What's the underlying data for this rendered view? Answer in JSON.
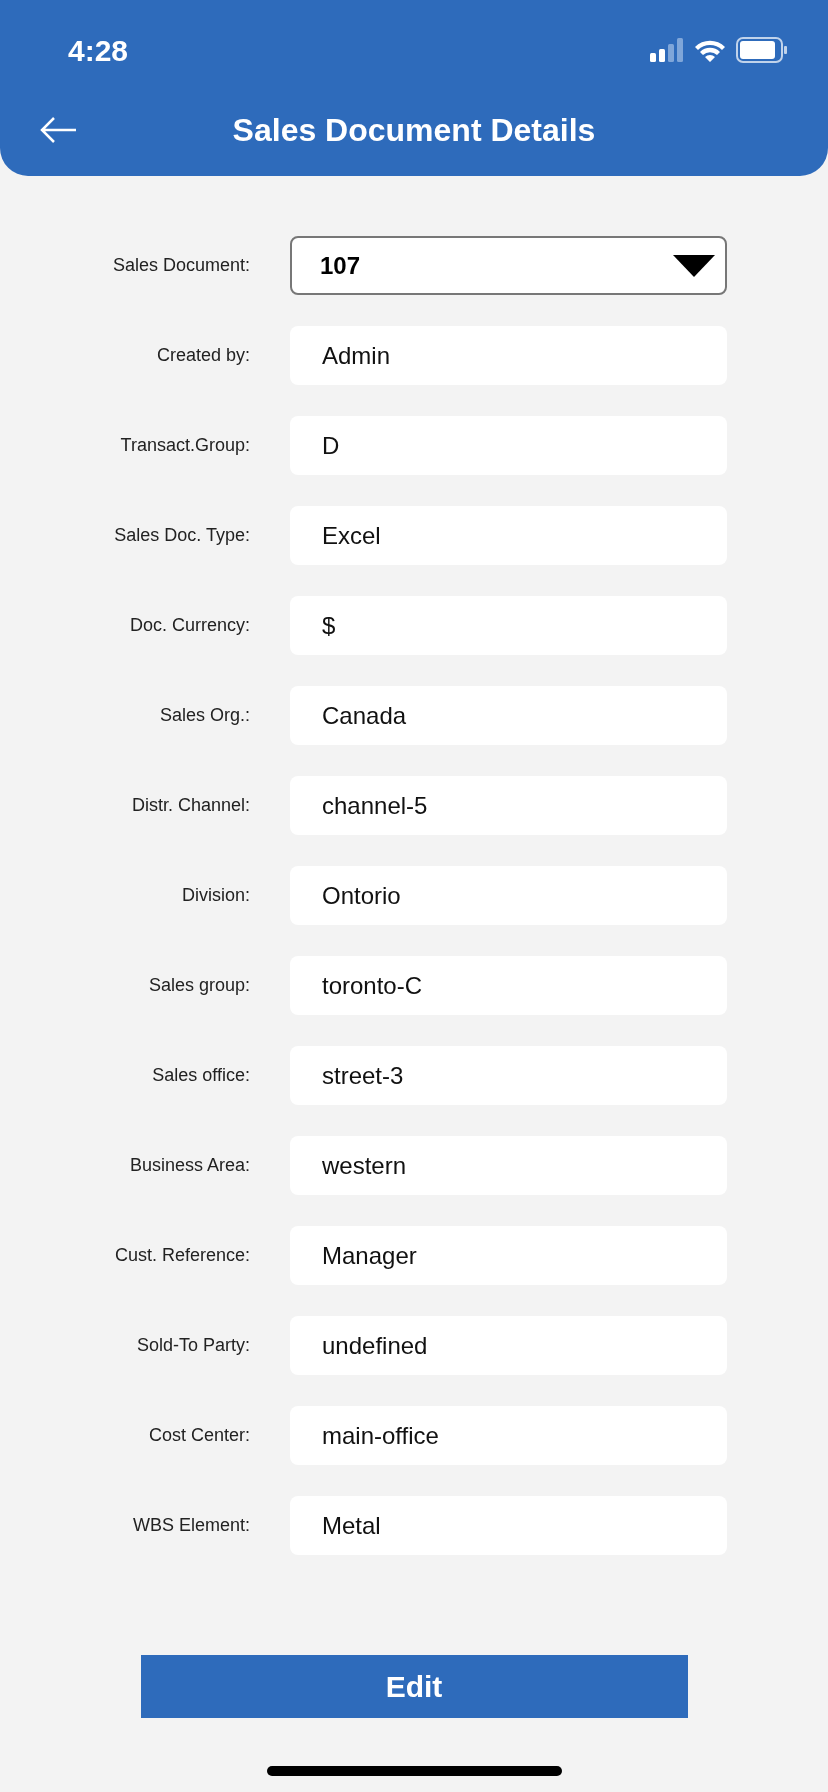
{
  "status_bar": {
    "time": "4:28"
  },
  "header": {
    "title": "Sales Document Details"
  },
  "fields": [
    {
      "kind": "dropdown",
      "label": "Sales Document:",
      "value": "107"
    },
    {
      "kind": "text",
      "label": "Created by:",
      "value": "Admin"
    },
    {
      "kind": "text",
      "label": "Transact.Group:",
      "value": "D"
    },
    {
      "kind": "text",
      "label": "Sales Doc. Type:",
      "value": "Excel"
    },
    {
      "kind": "text",
      "label": "Doc. Currency:",
      "value": "$"
    },
    {
      "kind": "text",
      "label": "Sales Org.:",
      "value": "Canada"
    },
    {
      "kind": "text",
      "label": "Distr. Channel:",
      "value": "channel-5"
    },
    {
      "kind": "text",
      "label": "Division:",
      "value": "Ontorio"
    },
    {
      "kind": "text",
      "label": "Sales group:",
      "value": "toronto-C"
    },
    {
      "kind": "text",
      "label": "Sales office:",
      "value": "street-3"
    },
    {
      "kind": "text",
      "label": "Business Area:",
      "value": "western"
    },
    {
      "kind": "text",
      "label": "Cust. Reference:",
      "value": "Manager"
    },
    {
      "kind": "text",
      "label": "Sold-To Party:",
      "value": "undefined"
    },
    {
      "kind": "text",
      "label": "Cost Center:",
      "value": "main-office"
    },
    {
      "kind": "text",
      "label": "WBS Element:",
      "value": "Metal"
    }
  ],
  "edit_button": {
    "label": "Edit"
  }
}
